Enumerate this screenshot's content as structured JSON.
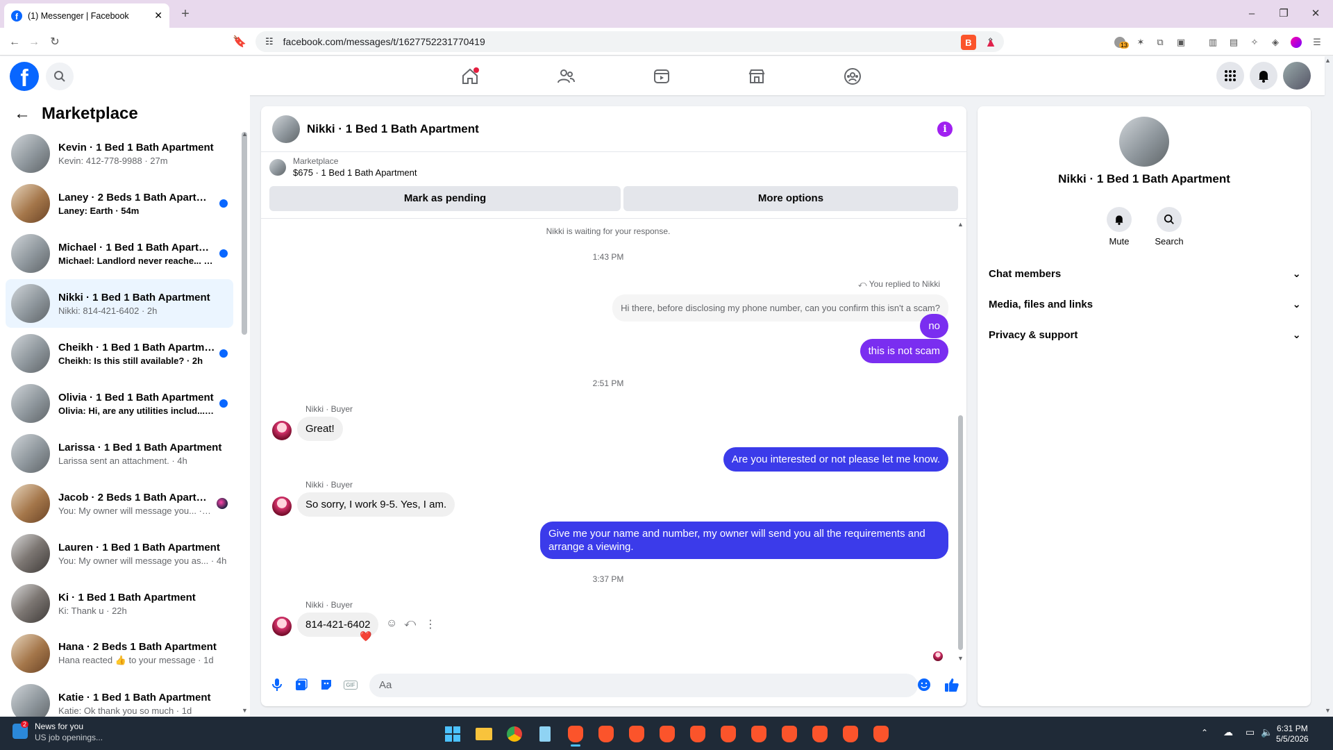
{
  "browser": {
    "tab_title": "(1) Messenger | Facebook",
    "url": "facebook.com/messages/t/1627752231770419",
    "ext_badge": "13"
  },
  "colors": {
    "fb_blue": "#0866ff",
    "outgoing_purple": "#7a2ef0",
    "outgoing_blue": "#3b3bea"
  },
  "sidebar": {
    "title": "Marketplace",
    "conversations": [
      {
        "name": "Kevin · 1 Bed 1 Bath Apartment",
        "preview": "Kevin: 412-778-9988 · 27m",
        "unread": false
      },
      {
        "name": "Laney · 2 Beds 1 Bath Apartment",
        "preview": "Laney: Earth · 54m",
        "unread": true
      },
      {
        "name": "Michael · 1 Bed 1 Bath Apartm...",
        "preview": "Michael: Landlord never reache... · 1h",
        "unread": true
      },
      {
        "name": "Nikki · 1 Bed 1 Bath Apartment",
        "preview": "Nikki: 814-421-6402 · 2h",
        "unread": false
      },
      {
        "name": "Cheikh · 1 Bed 1 Bath Apartment",
        "preview": "Cheikh: Is this still available? · 2h",
        "unread": true
      },
      {
        "name": "Olivia · 1 Bed 1 Bath Apartment",
        "preview": "Olivia: Hi, are any utilities includ... · 3h",
        "unread": true
      },
      {
        "name": "Larissa · 1 Bed 1 Bath Apartment",
        "preview": "Larissa sent an attachment. · 4h",
        "unread": false
      },
      {
        "name": "Jacob · 2 Beds 1 Bath Apartme...",
        "preview": "You: My owner will message you... · 4h",
        "unread": false
      },
      {
        "name": "Lauren · 1 Bed 1 Bath Apartment",
        "preview": "You: My owner will message you as... · 4h",
        "unread": false
      },
      {
        "name": "Ki · 1 Bed 1 Bath Apartment",
        "preview": "Ki: Thank u · 22h",
        "unread": false
      },
      {
        "name": "Hana · 2 Beds 1 Bath Apartment",
        "preview": "Hana reacted 👍 to your message · 1d",
        "unread": false
      },
      {
        "name": "Katie · 1 Bed 1 Bath Apartment",
        "preview": "Katie: Ok thank you so much · 1d",
        "unread": false
      }
    ]
  },
  "chat": {
    "title": "Nikki · 1 Bed 1 Bath Apartment",
    "marketplace_label": "Marketplace",
    "listing": "$675 · 1 Bed 1 Bath Apartment",
    "mark_pending": "Mark as pending",
    "more_options": "More options",
    "waiting_notice": "Nikki is waiting for your response.",
    "time1": "1:43 PM",
    "replied_label": "You replied to Nikki",
    "quoted": "Hi there, before disclosing my phone number, can you confirm this isn't a scam?",
    "out1": "no",
    "out2": "this is not scam",
    "time2": "2:51 PM",
    "sender_label": "Nikki · Buyer",
    "in1": "Great!",
    "out3": "Are you interested or not please let me know.",
    "in2": "So sorry, I work 9-5. Yes, I am.",
    "out4": "Give me your name and number, my owner will send you all the requirements and arrange a viewing.",
    "time3": "3:37 PM",
    "in3": "814-421-6402",
    "reaction": "❤️",
    "input_placeholder": "Aa"
  },
  "details": {
    "name": "Nikki · 1 Bed 1 Bath Apartment",
    "mute": "Mute",
    "search": "Search",
    "sections": [
      "Chat members",
      "Media, files and links",
      "Privacy & support"
    ]
  },
  "taskbar": {
    "news_title": "News for you",
    "news_sub": "US job openings...",
    "news_badge": "2",
    "time": "6:31 PM",
    "date": "5/5/2026"
  }
}
